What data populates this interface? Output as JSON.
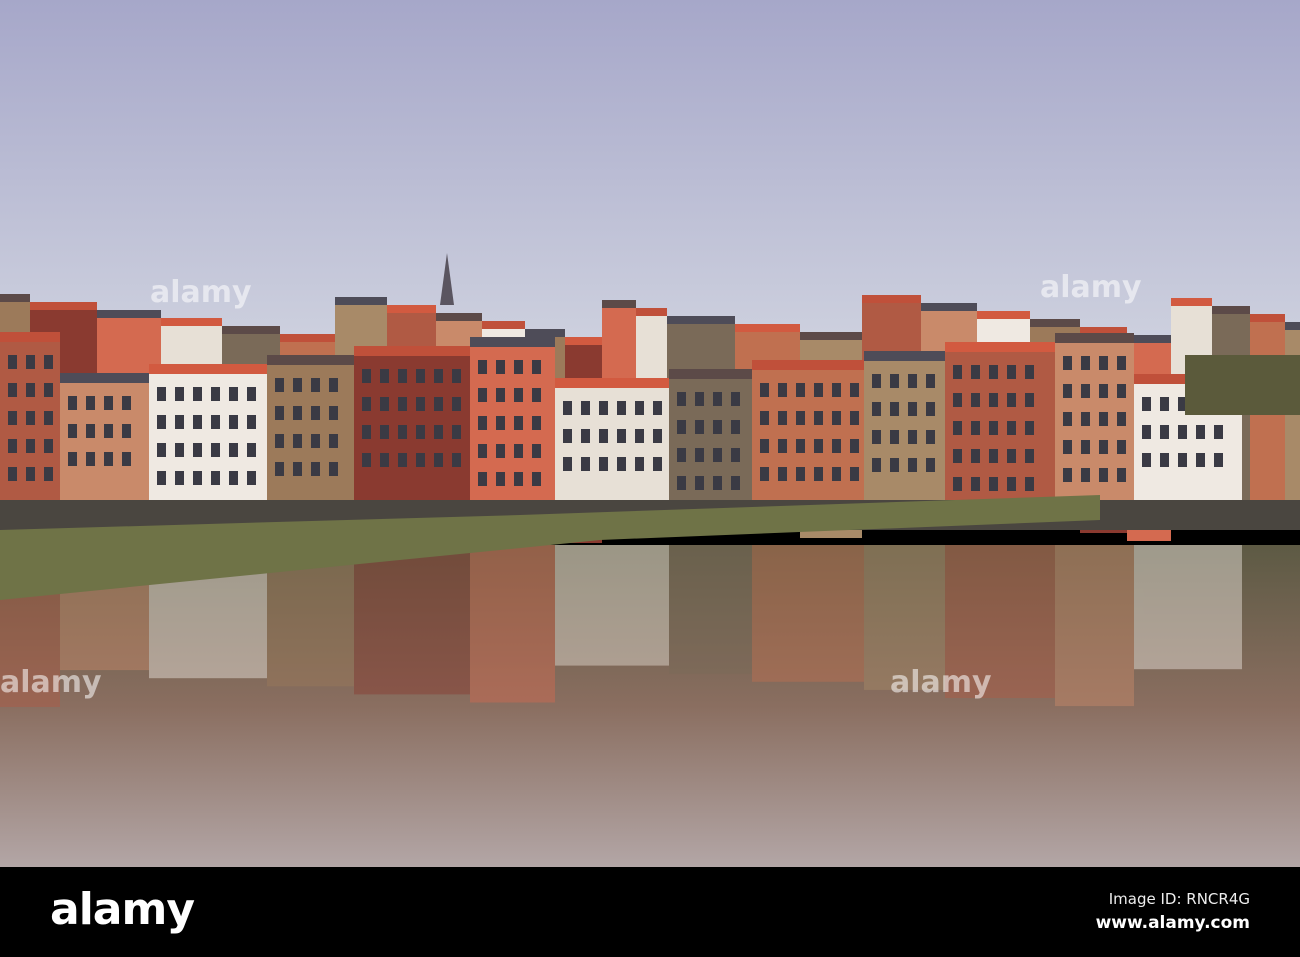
{
  "photo": {
    "subject": "Harbour town waterfront with reflections"
  },
  "footer": {
    "logo": "alamy",
    "image_id": "Image ID: RNCR4G",
    "url": "www.alamy.com"
  },
  "watermark": "alamy",
  "colors": {
    "sky_top": "#a9aacb",
    "sky_bottom": "#c8ccdc",
    "water": "#7a6a66",
    "bar": "#000000"
  }
}
